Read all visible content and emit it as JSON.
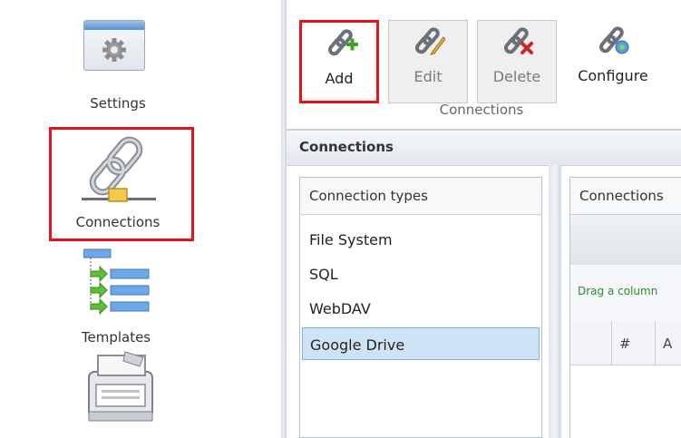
{
  "sidebar": {
    "items": [
      {
        "label": "Settings",
        "icon": "gear-icon"
      },
      {
        "label": "Connections",
        "icon": "chain-link-icon",
        "selected": true
      },
      {
        "label": "Templates",
        "icon": "templates-icon"
      },
      {
        "label": "",
        "icon": "printer-icon"
      }
    ]
  },
  "ribbon": {
    "buttons": [
      {
        "label": "Add",
        "icon": "link-add-icon",
        "enabled": true,
        "highlighted": true
      },
      {
        "label": "Edit",
        "icon": "link-edit-icon",
        "enabled": false
      },
      {
        "label": "Delete",
        "icon": "link-delete-icon",
        "enabled": false
      },
      {
        "label": "Configure",
        "icon": "link-configure-icon",
        "enabled": true
      }
    ],
    "group_caption": "Connections"
  },
  "section": {
    "title": "Connections"
  },
  "types_panel": {
    "header": "Connection types",
    "items": [
      "File System",
      "SQL",
      "WebDAV",
      "Google Drive"
    ],
    "selected": "Google Drive"
  },
  "connections_panel": {
    "header": "Connections",
    "group_hint": "Drag a column",
    "columns": [
      "",
      "#",
      "A"
    ]
  },
  "colors": {
    "highlight": "#e8121b",
    "selection": "#cfe3f7",
    "hint_text": "#2e8b2e"
  }
}
